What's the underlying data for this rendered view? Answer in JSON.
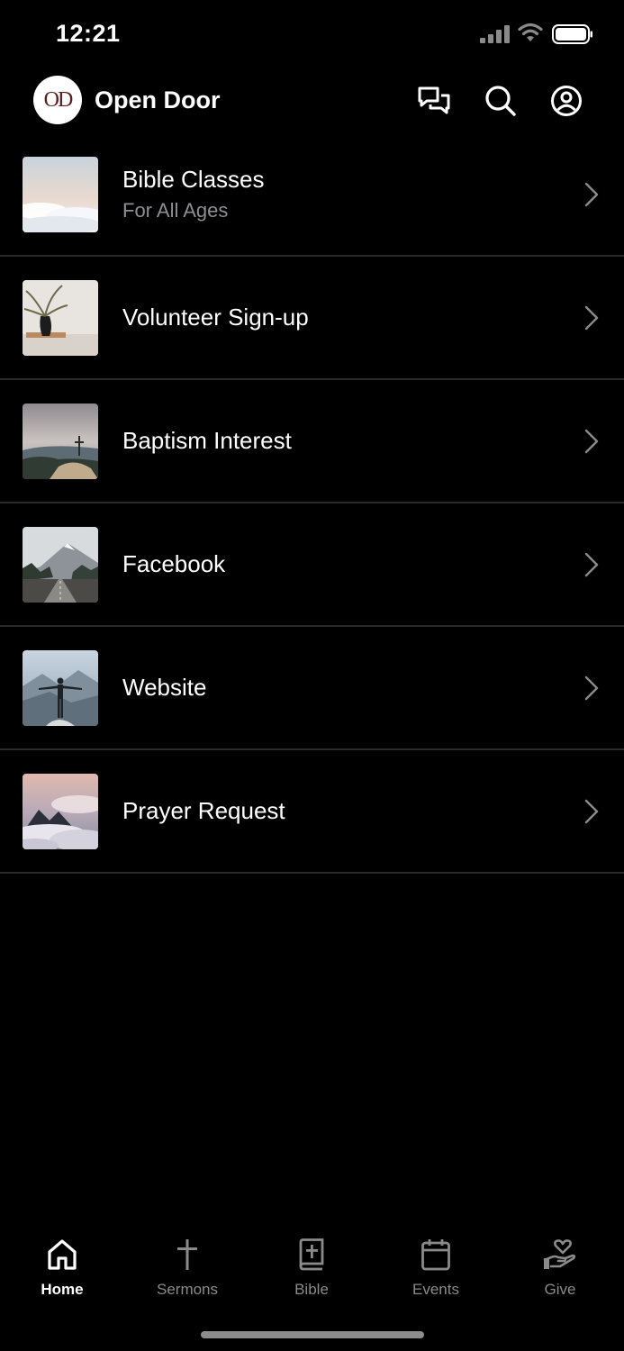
{
  "status_bar": {
    "time": "12:21",
    "icons": [
      "cellular-signal-icon",
      "wifi-icon",
      "battery-icon"
    ]
  },
  "header": {
    "logo_text": "OD",
    "title": "Open Door",
    "actions": [
      "chat-icon",
      "search-icon",
      "profile-icon"
    ]
  },
  "list": {
    "items": [
      {
        "title": "Bible Classes",
        "subtitle": "For All Ages",
        "thumbnail": "clouds-sunrise"
      },
      {
        "title": "Volunteer Sign-up",
        "subtitle": "",
        "thumbnail": "vase-plant"
      },
      {
        "title": "Baptism Interest",
        "subtitle": "",
        "thumbnail": "mountain-cross"
      },
      {
        "title": "Facebook",
        "subtitle": "",
        "thumbnail": "mountain-road"
      },
      {
        "title": "Website",
        "subtitle": "",
        "thumbnail": "person-mountain"
      },
      {
        "title": "Prayer Request",
        "subtitle": "",
        "thumbnail": "cloud-peaks"
      }
    ]
  },
  "tab_bar": {
    "tabs": [
      {
        "label": "Home",
        "icon": "home-icon",
        "active": true
      },
      {
        "label": "Sermons",
        "icon": "cross-icon",
        "active": false
      },
      {
        "label": "Bible",
        "icon": "bible-icon",
        "active": false
      },
      {
        "label": "Events",
        "icon": "calendar-icon",
        "active": false
      },
      {
        "label": "Give",
        "icon": "give-hand-heart-icon",
        "active": false
      }
    ]
  },
  "colors": {
    "background": "#000000",
    "text_primary": "#ffffff",
    "text_secondary": "#8e8e93",
    "divider": "#2a2a2a",
    "tab_inactive": "#8a8a8a",
    "logo_text": "#5a1e1e"
  }
}
